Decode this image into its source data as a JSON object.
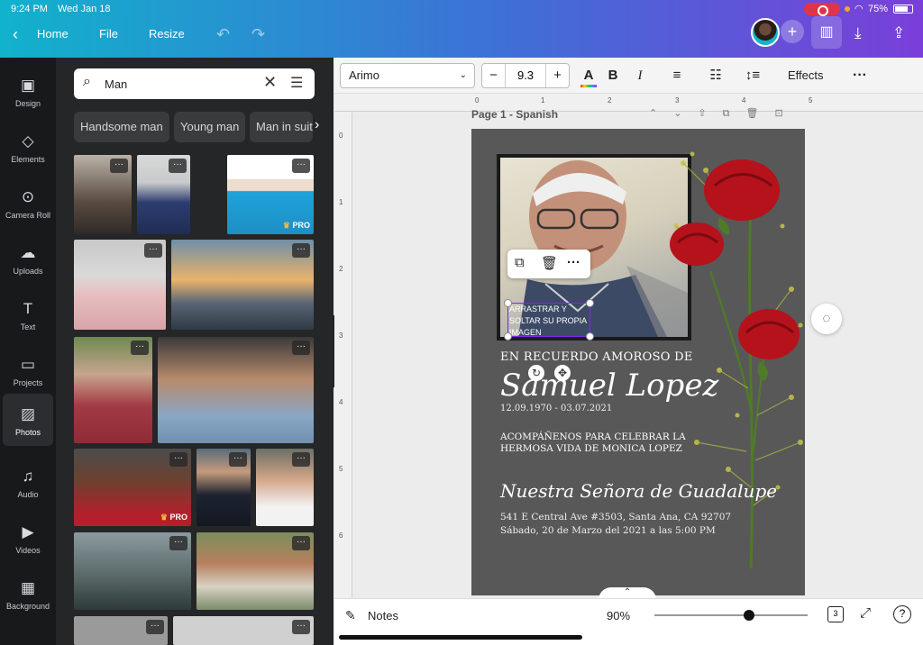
{
  "status": {
    "time": "9:24 PM",
    "date": "Wed Jan 18",
    "battery": "75%"
  },
  "topbar": {
    "home": "Home",
    "file": "File",
    "resize": "Resize"
  },
  "leftnav": {
    "items": [
      {
        "label": "Design",
        "icon": "design-icon"
      },
      {
        "label": "Elements",
        "icon": "elements-icon"
      },
      {
        "label": "Camera Roll",
        "icon": "camera-icon"
      },
      {
        "label": "Uploads",
        "icon": "upload-icon"
      },
      {
        "label": "Text",
        "icon": "text-icon"
      },
      {
        "label": "Projects",
        "icon": "folder-icon"
      },
      {
        "label": "Photos",
        "icon": "photos-icon"
      },
      {
        "label": "Audio",
        "icon": "audio-icon"
      },
      {
        "label": "Videos",
        "icon": "video-icon"
      },
      {
        "label": "Background",
        "icon": "background-icon"
      }
    ],
    "active": "Photos"
  },
  "panel": {
    "search_value": "Man",
    "chips": [
      "Handsome man",
      "Young man",
      "Man in suit"
    ],
    "pro_label": "PRO"
  },
  "toolbar": {
    "font": "Arimo",
    "size": "9.3",
    "minus": "−",
    "plus": "+",
    "effects": "Effects"
  },
  "ruler": {
    "top": [
      "0",
      "1",
      "2",
      "3",
      "4",
      "5"
    ],
    "left": [
      "0",
      "1",
      "2",
      "3",
      "4",
      "5",
      "6"
    ]
  },
  "page": {
    "label": "Page 1 - Spanish"
  },
  "card": {
    "placeholder": "ARRASTRAR Y SOLTAR SU PROPIA IMAGEN",
    "title": "EN RECUERDO AMOROSO DE",
    "name": "Samuel Lopez",
    "dates": "12.09.1970 - 03.07.2021",
    "body": "ACOMPÁÑENOS PARA CELEBRAR LA HERMOSA VIDA DE MONICA LOPEZ",
    "place": "Nuestra Señora de Guadalupe",
    "address1": "541 E Central Ave #3503, Santa Ana, CA 92707",
    "address2": "Sábado, 20 de Marzo del 2021 a las 5:00 PM"
  },
  "bottombar": {
    "notes": "Notes",
    "zoom": "90%",
    "zoom_level": 0.62,
    "pages": "3"
  },
  "colors": {
    "accent": "#7d2ae8",
    "card_bg": "#585858",
    "panel_bg": "#252627",
    "nav_bg": "#18191b"
  }
}
